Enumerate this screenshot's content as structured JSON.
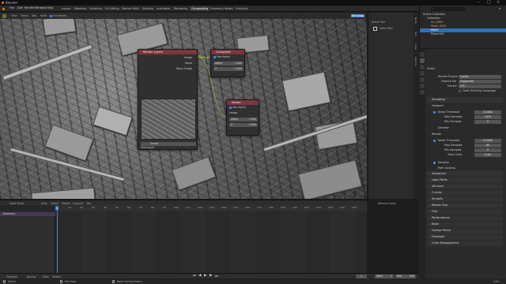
{
  "window": {
    "title": "Blender"
  },
  "menu": {
    "items": [
      "File",
      "Edit",
      "Render",
      "Window",
      "Help"
    ]
  },
  "node_toolbar": {
    "items": [
      "View",
      "Select",
      "Add",
      "Node"
    ],
    "use_nodes": "Use Nodes"
  },
  "workspaces": [
    "Layout",
    "Modeling",
    "Sculpting",
    "UV Editing",
    "Texture Paint",
    "Shading",
    "Animation",
    "Rendering",
    "Compositing",
    "Geometry Nodes",
    "Scripting"
  ],
  "active_workspace": "Compositing",
  "scene_selector": {
    "scene": "Scene",
    "view_layer": "ViewLayer"
  },
  "nodes": {
    "render_layers": {
      "title": "Render Layers",
      "outputs": [
        "Image",
        "Alpha",
        "Noisy Image"
      ],
      "scene": "Scene",
      "layer": "ViewLayer"
    },
    "composite": {
      "title": "Composite",
      "use_alpha": "Use Alpha",
      "fields": [
        {
          "label": "Alpha",
          "value": "1.000"
        },
        {
          "label": "Z",
          "value": "1.000"
        }
      ]
    },
    "viewer": {
      "title": "Viewer",
      "use_alpha": "Use Alpha",
      "input": "Image",
      "fields": [
        {
          "label": "Alpha",
          "value": "1.000"
        },
        {
          "label": "Z",
          "value": "1.000"
        }
      ]
    }
  },
  "n_panel": {
    "backdrop": "Backdrop",
    "active_tool": "Active Tool",
    "select_box": "Select Box",
    "tabs": [
      "Node",
      "Tool",
      "View",
      "Options"
    ]
  },
  "outliner": {
    "search_placeholder": "",
    "title": "Scene Collection",
    "rows": [
      {
        "label": "Scene Collection",
        "sel": false
      },
      {
        "label": "Collection",
        "sel": false
      },
      {
        "label": "Iris_0002",
        "sel": false
      },
      {
        "label": "Mane_0001",
        "sel": false
      },
      {
        "label": "Plane",
        "sel": true
      },
      {
        "label": "Plane.001",
        "sel": false
      }
    ]
  },
  "properties": {
    "scene": "Scene",
    "render_engine": {
      "label": "Render Engine",
      "value": "Cycles"
    },
    "feature_set": {
      "label": "Feature Set",
      "value": "Supported"
    },
    "device": {
      "label": "Device",
      "value": "CPU"
    },
    "osl": "Open Shading Language",
    "sampling": "Sampling",
    "viewport": "Viewport",
    "vp_noise": {
      "label": "Noise Threshold",
      "value": "0.1000"
    },
    "vp_max": {
      "label": "Max Samples",
      "value": "1024"
    },
    "vp_min": {
      "label": "Min Samples",
      "value": "0"
    },
    "denoise": "Denoise",
    "render": "Render",
    "r_noise": {
      "label": "Noise Threshold",
      "value": "0.0100"
    },
    "r_max": {
      "label": "Max Samples",
      "value": "64"
    },
    "r_min": {
      "label": "Min Samples",
      "value": "0"
    },
    "time_limit": {
      "label": "Time Limit",
      "value": "0 sec"
    },
    "r_denoise": "Denoise",
    "path_guiding": "Path Guiding",
    "panels": [
      "Advanced",
      "Light Paths",
      "Volumes",
      "Curves",
      "Simplify",
      "Motion Blur",
      "Film",
      "Performance",
      "Bake",
      "Grease Pencil",
      "Freestyle",
      "Color Management"
    ]
  },
  "dope_sheet": {
    "mode": "Dope Sheet",
    "menu": [
      "View",
      "Select",
      "Marker",
      "Channel",
      "Key"
    ],
    "summary": "Summary",
    "nearest_frame": "Nearest Frame",
    "ticks": [
      "0",
      "10",
      "20",
      "30",
      "40",
      "50",
      "60",
      "70",
      "80",
      "90",
      "100",
      "110",
      "120",
      "130",
      "140",
      "150",
      "160",
      "170",
      "180",
      "190",
      "200",
      "210",
      "220",
      "230",
      "240",
      "250"
    ],
    "current_frame": "1"
  },
  "playback": {
    "items": [
      "Playback",
      "Keying",
      "View",
      "Marker"
    ],
    "frame": "1",
    "start_label": "Start",
    "start": "1",
    "end_label": "End",
    "end": "250"
  },
  "statusbar": {
    "left": "Select",
    "mid": "Pan View",
    "right": "Node Context Menu",
    "version": "3.6.0"
  }
}
